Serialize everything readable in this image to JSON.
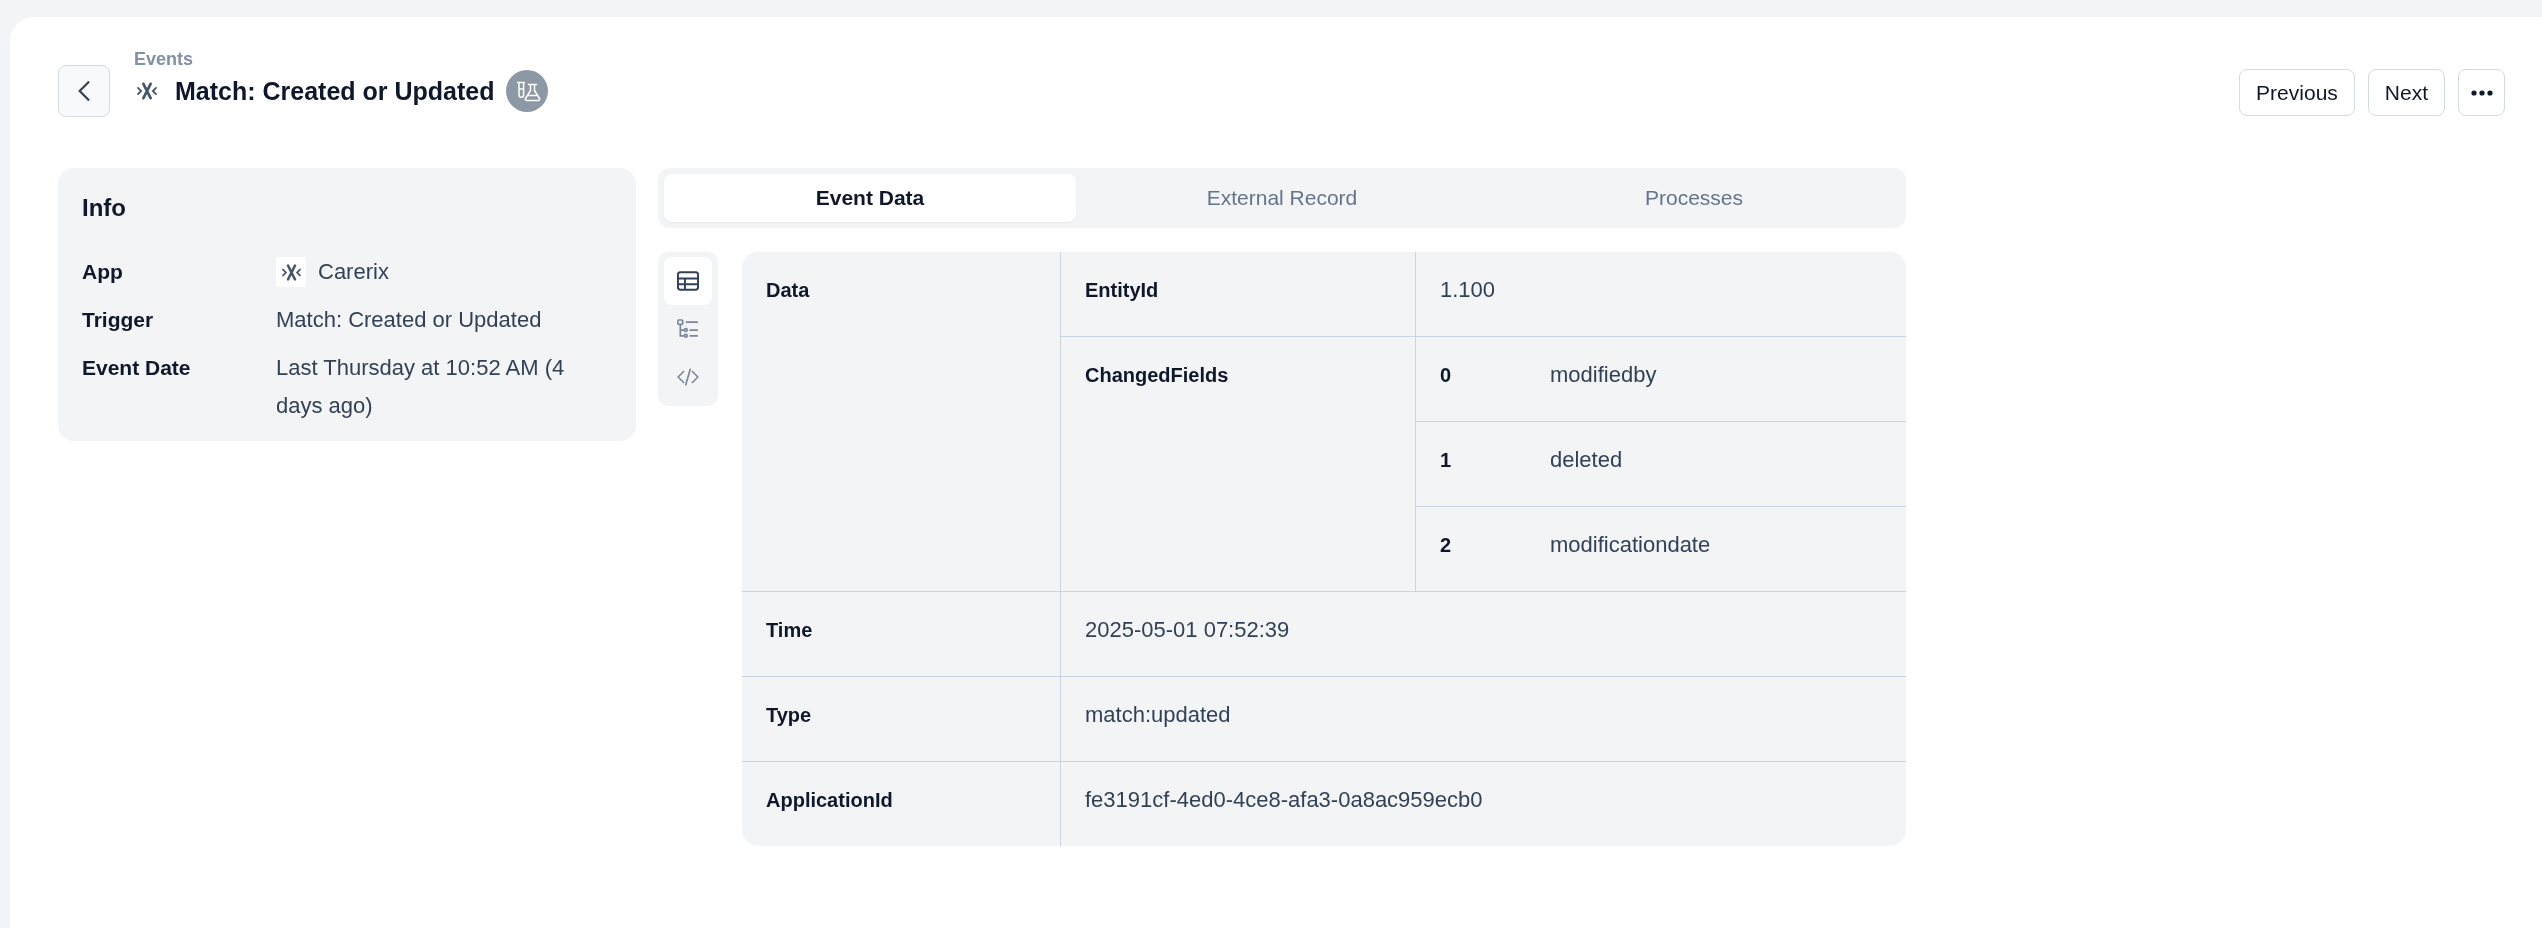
{
  "header": {
    "breadcrumb": "Events",
    "title": "Match: Created or Updated",
    "actions": [
      {
        "kind": "text",
        "label": "Previous"
      },
      {
        "kind": "text",
        "label": "Next"
      },
      {
        "kind": "more"
      }
    ]
  },
  "info": {
    "title": "Info",
    "rows": [
      {
        "kind": "app",
        "label": "App",
        "value": "Carerix"
      },
      {
        "kind": "text",
        "label": "Trigger",
        "value": "Match: Created or Updated"
      },
      {
        "kind": "text",
        "label": "Event Date",
        "value": "Last Thursday at 10:52 AM (4 days ago)"
      }
    ]
  },
  "tabs": [
    {
      "label": "Event Data",
      "selected": true
    },
    {
      "label": "External Record",
      "selected": false
    },
    {
      "label": "Processes",
      "selected": false
    }
  ],
  "view_modes": [
    {
      "kind": "table",
      "selected": true
    },
    {
      "kind": "tree",
      "selected": false
    },
    {
      "kind": "code",
      "selected": false
    }
  ],
  "data": {
    "rows": [
      {
        "key": "Data",
        "children": [
          {
            "key": "EntityId",
            "value": "1.100"
          },
          {
            "key": "ChangedFields",
            "items": [
              {
                "index": "0",
                "value": "modifiedby"
              },
              {
                "index": "1",
                "value": "deleted"
              },
              {
                "index": "2",
                "value": "modificationdate"
              }
            ]
          }
        ]
      },
      {
        "key": "Time",
        "value": "2025-05-01 07:52:39"
      },
      {
        "key": "Type",
        "value": "match:updated"
      },
      {
        "key": "ApplicationId",
        "value": "fe3191cf-4ed0-4ce8-afa3-0a8ac959ecb0"
      }
    ]
  }
}
